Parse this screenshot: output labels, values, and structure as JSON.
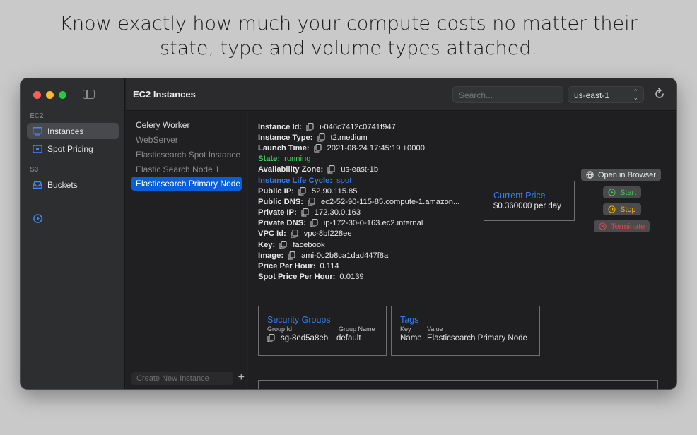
{
  "headline": {
    "line1": "Know exactly how much your compute costs no matter their",
    "line2": "state, type and volume types attached."
  },
  "sidebar": {
    "sections": [
      {
        "label": "EC2",
        "items": [
          {
            "label": "Instances",
            "icon": "monitor-icon",
            "active": true
          },
          {
            "label": "Spot Pricing",
            "icon": "spot-pricing-icon",
            "active": false
          }
        ]
      },
      {
        "label": "S3",
        "items": [
          {
            "label": "Buckets",
            "icon": "tray-icon",
            "active": false
          }
        ]
      },
      {
        "label": "",
        "items": [
          {
            "label": "Settings & Help",
            "icon": "settings-help-icon",
            "active": false
          }
        ]
      }
    ]
  },
  "toolbar": {
    "title": "EC2 Instances",
    "search_placeholder": "Search...",
    "region": "us-east-1"
  },
  "instances": {
    "items": [
      {
        "label": "Celery Worker",
        "state": "enabled"
      },
      {
        "label": "WebServer",
        "state": "disabled"
      },
      {
        "label": "Elasticsearch Spot Instance",
        "state": "disabled"
      },
      {
        "label": "Elastic Search Node 1",
        "state": "disabled"
      },
      {
        "label": "Elasticsearch Primary Node",
        "state": "selected"
      }
    ],
    "create_placeholder": "Create New Instance",
    "add_label": "+"
  },
  "details": {
    "rows": [
      {
        "key": "Instance Id:",
        "value": "i-046c7412c0741f947",
        "copy": true,
        "style": ""
      },
      {
        "key": "Instance Type:",
        "value": "t2.medium",
        "copy": true,
        "style": ""
      },
      {
        "key": "Launch Time:",
        "value": "2021-08-24 17:45:19 +0000",
        "copy": true,
        "style": ""
      },
      {
        "key": "State:",
        "value": "running",
        "copy": false,
        "style": "green"
      },
      {
        "key": "Availability Zone:",
        "value": "us-east-1b",
        "copy": true,
        "style": ""
      },
      {
        "key": "Instance Life Cycle:",
        "value": "spot",
        "copy": false,
        "style": "blue"
      },
      {
        "key": "Public IP:",
        "value": "52.90.115.85",
        "copy": true,
        "style": ""
      },
      {
        "key": "Public DNS:",
        "value": "ec2-52-90-115-85.compute-1.amazon...",
        "copy": true,
        "style": ""
      },
      {
        "key": "Private IP:",
        "value": "172.30.0.163",
        "copy": true,
        "style": ""
      },
      {
        "key": "Private DNS:",
        "value": "ip-172-30-0-163.ec2.internal",
        "copy": true,
        "style": ""
      },
      {
        "key": "VPC Id:",
        "value": "vpc-8bf228ee",
        "copy": true,
        "style": ""
      },
      {
        "key": "Key:",
        "value": "facebook",
        "copy": true,
        "style": ""
      },
      {
        "key": "Image:",
        "value": "ami-0c2b8ca1dad447f8a",
        "copy": true,
        "style": ""
      },
      {
        "key": "Price Per Hour:",
        "value": "0.114",
        "copy": false,
        "style": ""
      },
      {
        "key": "Spot Price Per Hour:",
        "value": "0.0139",
        "copy": false,
        "style": ""
      }
    ]
  },
  "price": {
    "title": "Current Price",
    "value": "$0.360000 per day"
  },
  "actions": {
    "browser": "Open in Browser",
    "start": "Start",
    "stop": "Stop",
    "terminate": "Terminate"
  },
  "security_groups": {
    "title": "Security Groups",
    "col_id": "Group Id",
    "col_name": "Group Name",
    "id": "sg-8ed5a8eb",
    "name": "default"
  },
  "tags": {
    "title": "Tags",
    "col_key": "Key",
    "col_value": "Value",
    "key": "Name",
    "value": "Elasticsearch Primary Node"
  },
  "colors": {
    "accent": "#0a5fd8",
    "link_blue": "#2f7ff0",
    "running_green": "#39d353",
    "stop_yellow": "#f5b800",
    "terminate_red": "#e04545"
  }
}
